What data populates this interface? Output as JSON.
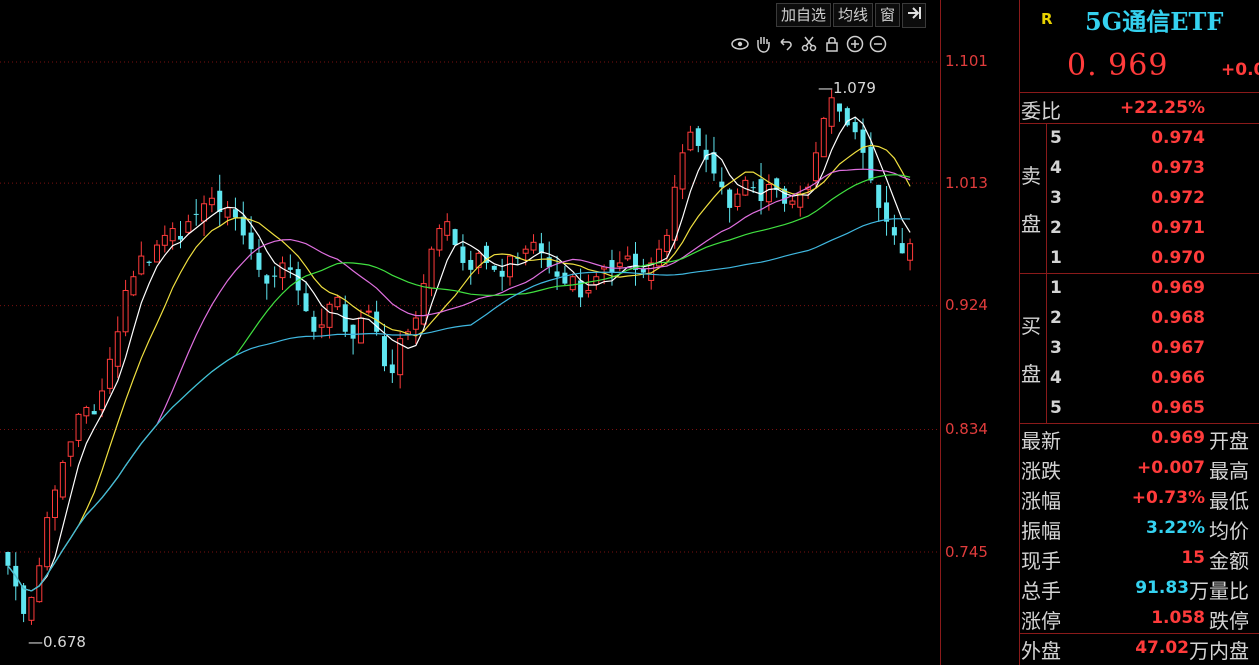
{
  "toolbar": {
    "add_watch": "加自选",
    "ma_line": "均线",
    "window": "窗",
    "expand_icon": "expand-panel-icon"
  },
  "tool_icons": [
    "eye-icon",
    "hand-icon",
    "undo-icon",
    "scissors-icon",
    "lock-icon",
    "zoom-in-icon",
    "zoom-out-icon"
  ],
  "price_axis": {
    "ticks": [
      "1.101",
      "1.013",
      "0.924",
      "0.834",
      "0.745"
    ]
  },
  "annotations": {
    "high": "1.079",
    "low": "0.678"
  },
  "chart_data": {
    "type": "candlestick",
    "ylim": [
      0.66,
      1.12
    ],
    "ticks": [
      1.101,
      1.013,
      0.924,
      0.834,
      0.745
    ],
    "high_label": 1.079,
    "low_label": 0.678,
    "colors": {
      "up": "#ff3b3b",
      "down": "#5fe6f0",
      "ma5": "#ffffff",
      "ma10": "#f0e040",
      "ma20": "#e070e0",
      "ma30": "#40e040",
      "ma60": "#40b8e0"
    },
    "closes": [
      0.735,
      0.72,
      0.7,
      0.712,
      0.735,
      0.77,
      0.79,
      0.81,
      0.825,
      0.845,
      0.85,
      0.845,
      0.862,
      0.885,
      0.905,
      0.935,
      0.945,
      0.96,
      0.955,
      0.968,
      0.975,
      0.98,
      0.972,
      0.985,
      0.99,
      0.998,
      1.002,
      0.992,
      0.995,
      0.988,
      0.975,
      0.965,
      0.95,
      0.94,
      0.945,
      0.955,
      0.95,
      0.935,
      0.92,
      0.905,
      0.91,
      0.925,
      0.93,
      0.905,
      0.9,
      0.915,
      0.92,
      0.905,
      0.88,
      0.875,
      0.9,
      0.905,
      0.915,
      0.94,
      0.965,
      0.98,
      0.985,
      0.968,
      0.955,
      0.95,
      0.962,
      0.955,
      0.95,
      0.945,
      0.96,
      0.958,
      0.965,
      0.97,
      0.962,
      0.952,
      0.945,
      0.94,
      0.945,
      0.93,
      0.935,
      0.945,
      0.952,
      0.948,
      0.955,
      0.96,
      0.95,
      0.948,
      0.955,
      0.965,
      0.975,
      1.01,
      1.035,
      1.05,
      1.04,
      1.03,
      1.02,
      1.01,
      0.995,
      1.005,
      1.015,
      1.01,
      1.0,
      1.012,
      1.008,
      0.998,
      1.0,
      1.005,
      1.01,
      1.035,
      1.06,
      1.075,
      1.065,
      1.055,
      1.05,
      1.035,
      1.015,
      0.995,
      0.985,
      0.975,
      0.962,
      0.969
    ],
    "series": [
      "MA5",
      "MA10",
      "MA20",
      "MA30",
      "MA60"
    ]
  },
  "quote": {
    "r_mark": "R",
    "name": "5G通信ETF",
    "price": "0. 969",
    "change_short": "+0.0",
    "ratio_label": "委比",
    "ratio_value": "+22.25%",
    "sell_label_1": "卖",
    "sell_label_2": "盘",
    "buy_label_1": "买",
    "buy_label_2": "盘",
    "sell": [
      {
        "level": "5",
        "price": "0.974"
      },
      {
        "level": "4",
        "price": "0.973"
      },
      {
        "level": "3",
        "price": "0.972"
      },
      {
        "level": "2",
        "price": "0.971"
      },
      {
        "level": "1",
        "price": "0.970"
      }
    ],
    "buy": [
      {
        "level": "1",
        "price": "0.969"
      },
      {
        "level": "2",
        "price": "0.968"
      },
      {
        "level": "3",
        "price": "0.967"
      },
      {
        "level": "4",
        "price": "0.966"
      },
      {
        "level": "5",
        "price": "0.965"
      }
    ],
    "stats": [
      {
        "label": "最新",
        "value": "0.969",
        "value_color": "red",
        "right": "开盘"
      },
      {
        "label": "涨跌",
        "value": "+0.007",
        "value_color": "red",
        "right": "最高"
      },
      {
        "label": "涨幅",
        "value": "+0.73%",
        "value_color": "red",
        "right": "最低"
      },
      {
        "label": "振幅",
        "value": "3.22%",
        "value_color": "cyan",
        "right": "均价"
      },
      {
        "label": "现手",
        "value": "15",
        "value_color": "red",
        "right": "金额"
      },
      {
        "label": "总手",
        "value": "91.83",
        "value_unit": "万",
        "value_color": "cyan",
        "right": "量比"
      },
      {
        "label": "涨停",
        "value": "1.058",
        "value_color": "red",
        "right": "跌停"
      },
      {
        "label": "外盘",
        "value": "47.02",
        "value_unit": "万",
        "value_color": "red",
        "right": "内盘"
      }
    ]
  }
}
